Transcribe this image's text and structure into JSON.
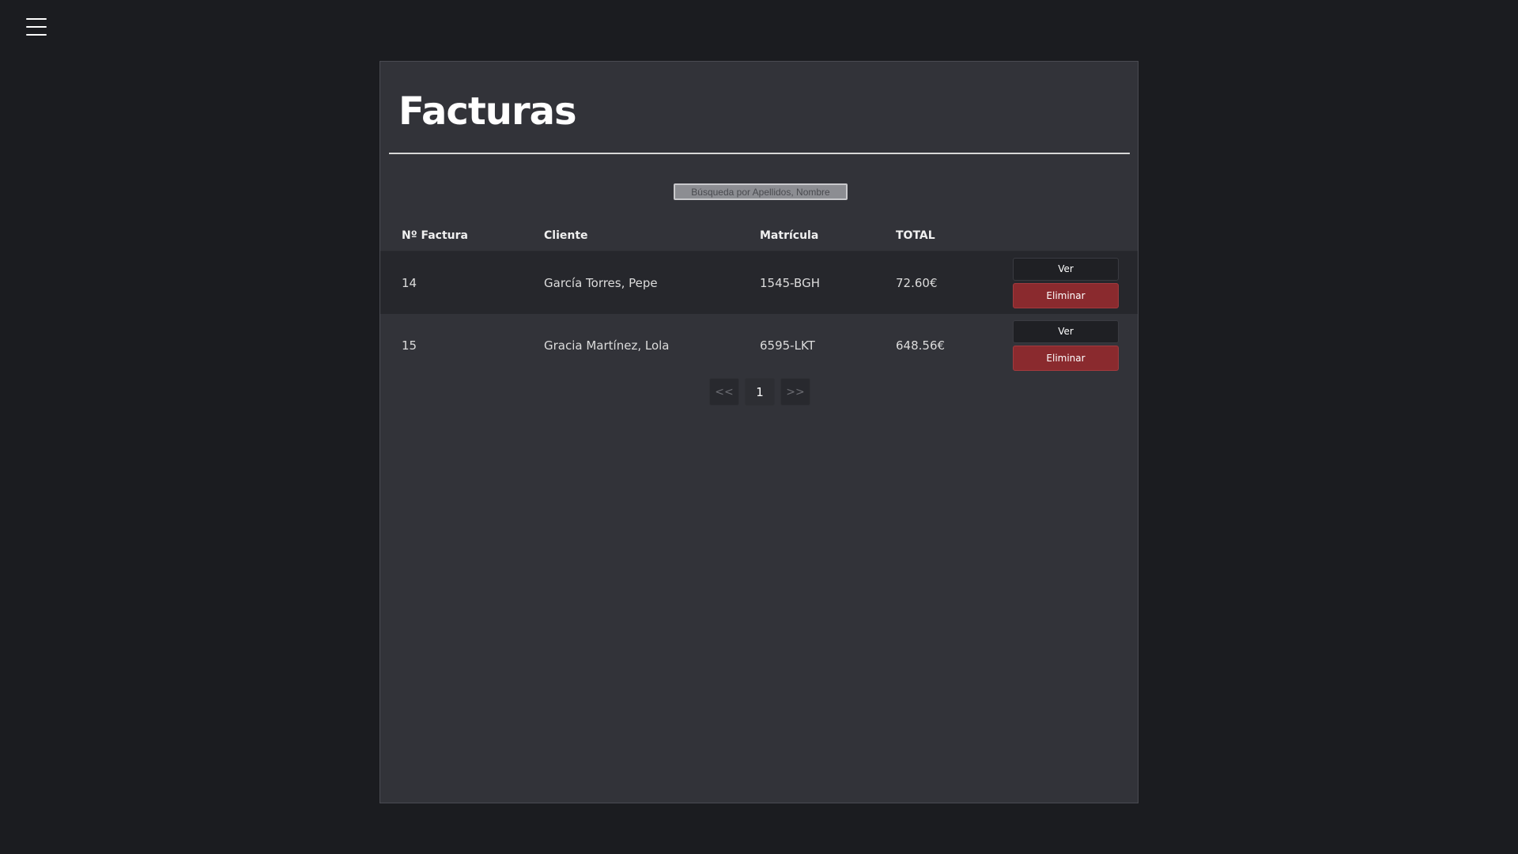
{
  "nav": {
    "menu_icon": "hamburger-menu-icon"
  },
  "page": {
    "title": "Facturas"
  },
  "search": {
    "placeholder": "Búsqueda por Apellidos, Nombre",
    "value": ""
  },
  "table": {
    "headers": [
      "Nº Factura",
      "Cliente",
      "Matrícula",
      "TOTAL"
    ],
    "rows": [
      {
        "numero": "14",
        "cliente": "García Torres, Pepe",
        "matricula": "1545-BGH",
        "total": "72.60€"
      },
      {
        "numero": "15",
        "cliente": "Gracia Martínez, Lola",
        "matricula": "6595-LKT",
        "total": "648.56€"
      }
    ],
    "actions": {
      "view_label": "Ver",
      "delete_label": "Eliminar"
    }
  },
  "pagination": {
    "prev": "<<",
    "current": "1",
    "next": ">>"
  },
  "colors": {
    "background": "#1b1c20",
    "panel": "#323339",
    "danger": "#8a2a2e"
  }
}
